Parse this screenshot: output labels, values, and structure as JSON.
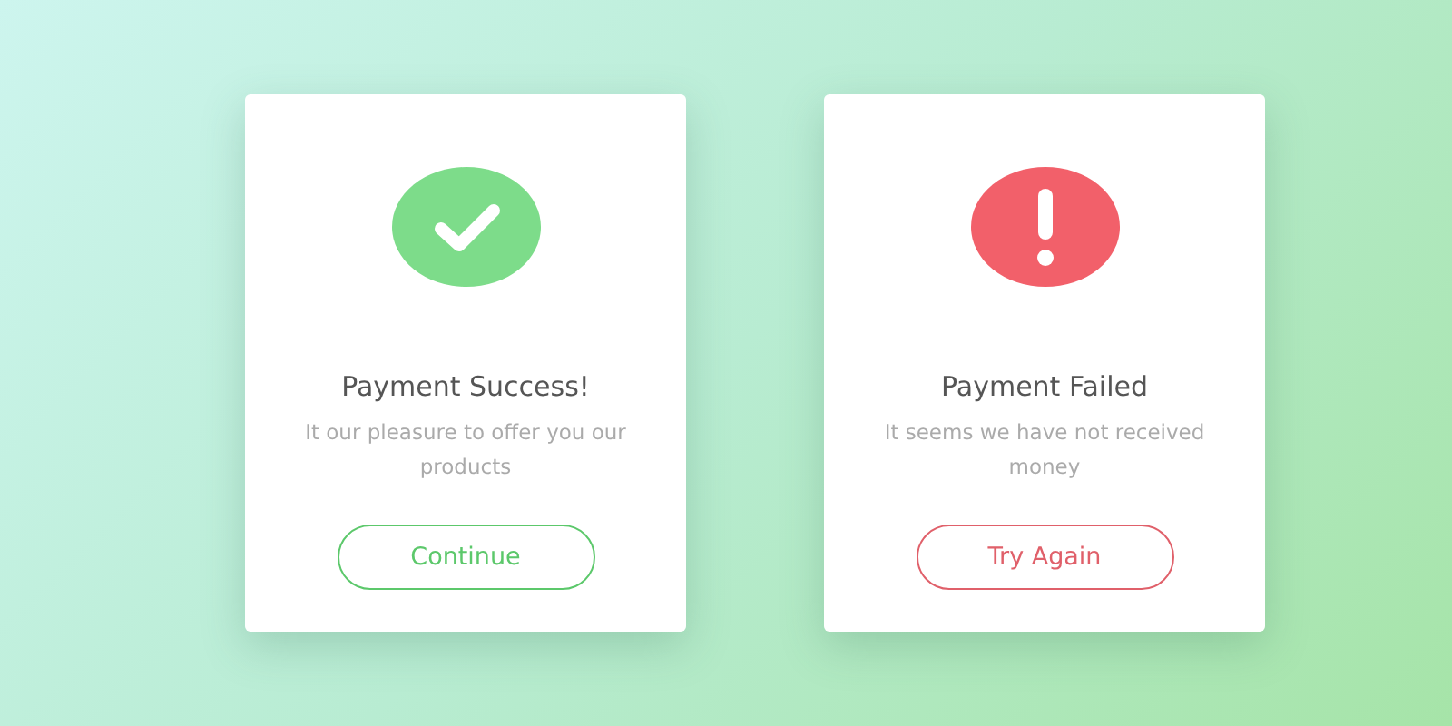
{
  "cards": [
    {
      "kind": "success",
      "title": "Payment Success!",
      "message": "It our pleasure to offer you our products",
      "button": "Continue"
    },
    {
      "kind": "failure",
      "title": "Payment Failed",
      "message": "It seems we have not received money",
      "button": "Try Again"
    }
  ]
}
